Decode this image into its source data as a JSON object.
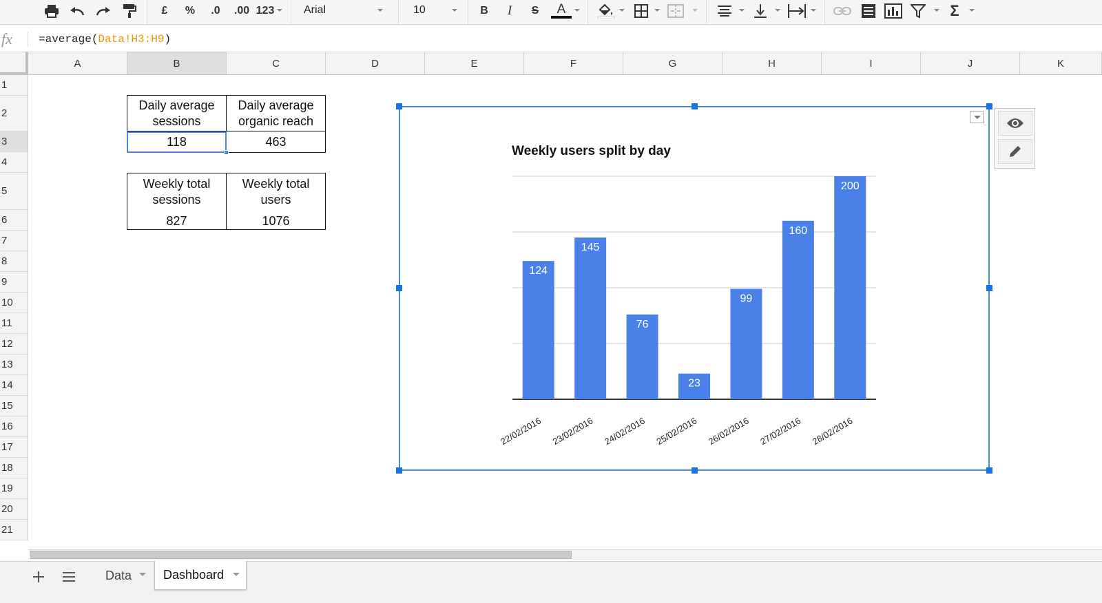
{
  "toolbar": {
    "currency_label": "£",
    "percent_label": "%",
    "decimal_decrease_label": ".0",
    "decimal_increase_label": ".00",
    "more_formats_label": "123",
    "font_family_value": "Arial",
    "font_size_value": "10",
    "bold_label": "B",
    "italic_label": "I",
    "strike_label": "S",
    "text_color_label": "A",
    "sum_label": "Σ"
  },
  "formula_bar": {
    "fx_label": "fx",
    "prefix": "=average(",
    "reference": "Data!H3:H9",
    "suffix": ")"
  },
  "grid": {
    "columns": [
      "A",
      "B",
      "C",
      "D",
      "E",
      "F",
      "G",
      "H",
      "I",
      "J",
      "K"
    ],
    "rows": [
      "1",
      "2",
      "3",
      "4",
      "5",
      "6",
      "7",
      "8",
      "9",
      "10",
      "11",
      "12",
      "13",
      "14",
      "15",
      "16",
      "17",
      "18",
      "19",
      "20",
      "21"
    ],
    "active_column": "B",
    "active_row": "3"
  },
  "summary": {
    "daily_sessions_header": "Daily average sessions",
    "daily_reach_header": "Daily average organic reach",
    "daily_sessions_value": "118",
    "daily_reach_value": "463",
    "weekly_sessions_header": "Weekly total sessions",
    "weekly_users_header": "Weekly total users",
    "weekly_sessions_value": "827",
    "weekly_users_value": "1076"
  },
  "chart_data": {
    "type": "bar",
    "title": "Weekly users split by day",
    "categories": [
      "22/02/2016",
      "23/02/2016",
      "24/02/2016",
      "25/02/2016",
      "26/02/2016",
      "27/02/2016",
      "28/02/2016"
    ],
    "values": [
      124,
      145,
      76,
      23,
      99,
      160,
      200
    ],
    "ylim": [
      0,
      200
    ],
    "grid": true,
    "color": "#4a81e8"
  },
  "sheets": {
    "tabs": [
      {
        "label": "Data",
        "active": false
      },
      {
        "label": "Dashboard",
        "active": true
      }
    ]
  }
}
